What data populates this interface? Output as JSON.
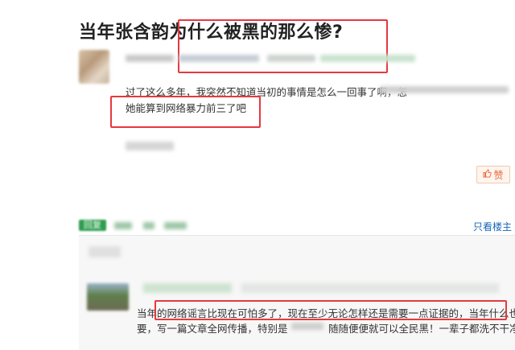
{
  "post": {
    "title": "当年张含韵为什么被黑的那么惨?",
    "body_line1": "过了这么多年，我突然不知道当初的事情是怎么一回事了啊，怎",
    "body_line2": "她能算到网络暴力前三了吧"
  },
  "like": {
    "label": "赞",
    "icon": "thumbs-up-icon"
  },
  "actions": {
    "reply_label": "回复",
    "only_owner_label": "只看楼主"
  },
  "reply": {
    "line1": "当年的网络谣言比现在可怕多了，现在至少无论怎样还是需要一点证据的，当年什么也不需",
    "line2_a": "要，写一篇文章全网传播，特别是",
    "line2_b": "随随便便就可以全民黑！一辈子都洗不干净!"
  },
  "colors": {
    "highlight_border": "#e6393f",
    "action_green": "#1d7a3c",
    "link_blue": "#1a66b5",
    "like_orange": "#e6683b"
  }
}
